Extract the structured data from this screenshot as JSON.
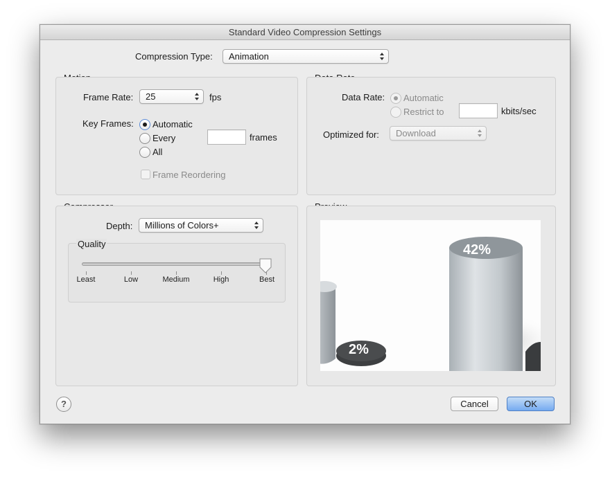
{
  "window": {
    "title": "Standard Video Compression Settings"
  },
  "compression_type": {
    "label": "Compression Type:",
    "value": "Animation"
  },
  "motion": {
    "title": "Motion",
    "frame_rate_label": "Frame Rate:",
    "frame_rate_value": "25",
    "fps_unit": "fps",
    "key_frames_label": "Key Frames:",
    "key_frames_options": [
      "Automatic",
      "Every",
      "All"
    ],
    "key_frames_selected": "Automatic",
    "every_value": "",
    "frames_unit": "frames",
    "frame_reordering_label": "Frame Reordering",
    "frame_reordering_checked": false
  },
  "data_rate": {
    "title": "Data Rate",
    "data_rate_label": "Data Rate:",
    "options": [
      "Automatic",
      "Restrict to"
    ],
    "selected": "Automatic",
    "restrict_value": "",
    "unit": "kbits/sec",
    "optimized_label": "Optimized for:",
    "optimized_value": "Download"
  },
  "compressor": {
    "title": "Compressor",
    "depth_label": "Depth:",
    "depth_value": "Millions of Colors+",
    "quality": {
      "title": "Quality",
      "tick_labels": [
        "Least",
        "Low",
        "Medium",
        "High",
        "Best"
      ],
      "value_label": "Best",
      "level_fraction": 1.0
    }
  },
  "preview": {
    "title": "Preview",
    "labels": [
      "2%",
      "42%"
    ]
  },
  "footer": {
    "help_label": "?",
    "cancel_label": "Cancel",
    "ok_label": "OK"
  },
  "colors": {
    "accent": "#75aaf0",
    "window_bg": "#ececec"
  }
}
